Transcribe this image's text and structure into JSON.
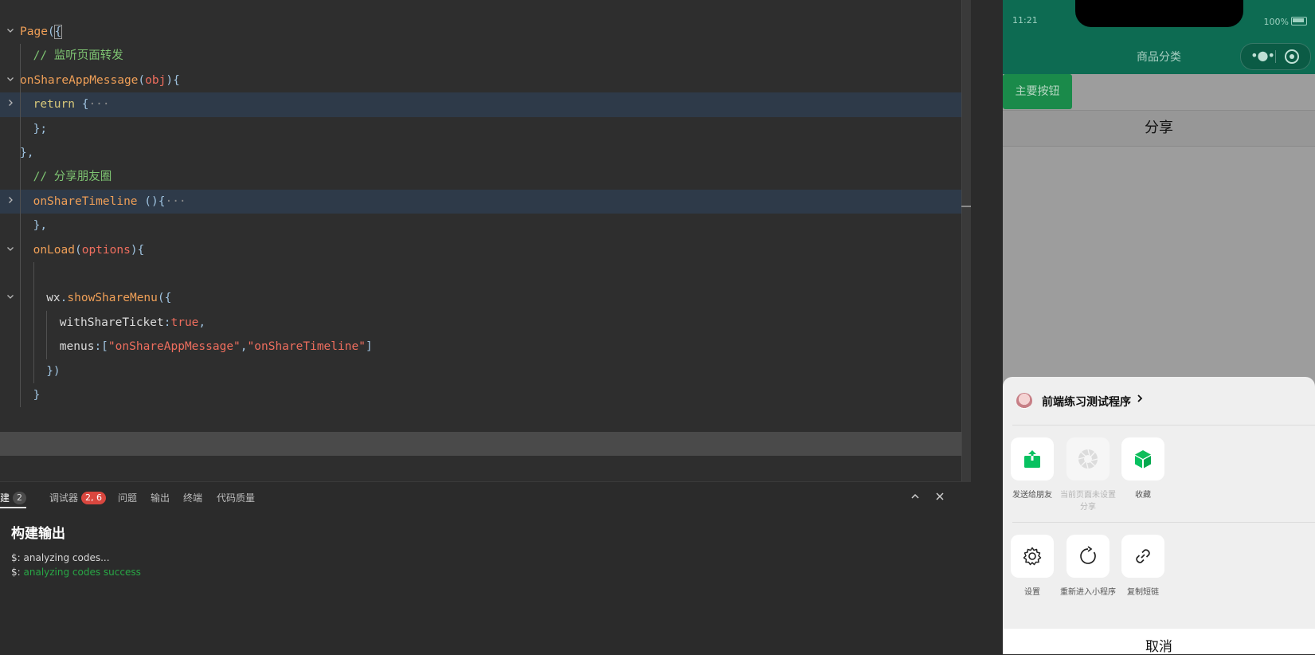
{
  "editor": {
    "lines": [
      {
        "fold": "open",
        "tokens": [
          {
            "t": "Page",
            "c": "fn"
          },
          {
            "t": "(",
            "c": "punc"
          },
          {
            "t": "{",
            "c": "punc",
            "box": true
          }
        ]
      },
      {
        "indent": 1,
        "tokens": [
          {
            "t": "// 监听页面转发",
            "c": "comment"
          }
        ]
      },
      {
        "fold": "open",
        "tokens": [
          {
            "t": "onShareAppMessage",
            "c": "fn"
          },
          {
            "t": "(",
            "c": "punc"
          },
          {
            "t": "obj",
            "c": "param"
          },
          {
            "t": "){",
            "c": "punc"
          }
        ]
      },
      {
        "fold": "closed",
        "hl": true,
        "indent": 1,
        "tokens": [
          {
            "t": "return ",
            "c": "kw"
          },
          {
            "t": "{",
            "c": "punc"
          },
          {
            "t": "···",
            "c": "ellipsis"
          }
        ]
      },
      {
        "indent": 1,
        "tokens": [
          {
            "t": "};",
            "c": "punc"
          }
        ]
      },
      {
        "tokens": [
          {
            "t": "},",
            "c": "punc"
          }
        ]
      },
      {
        "indent": 1,
        "tokens": [
          {
            "t": "// 分享朋友圈",
            "c": "comment"
          }
        ]
      },
      {
        "fold": "closed",
        "hl": true,
        "indent": 1,
        "tokens": [
          {
            "t": "onShareTimeline",
            "c": "fn"
          },
          {
            "t": " (){",
            "c": "punc"
          },
          {
            "t": "···",
            "c": "ellipsis"
          }
        ]
      },
      {
        "indent": 1,
        "tokens": [
          {
            "t": "},",
            "c": "punc"
          }
        ]
      },
      {
        "fold": "open",
        "indent": 1,
        "tokens": [
          {
            "t": "onLoad",
            "c": "fn"
          },
          {
            "t": "(",
            "c": "punc"
          },
          {
            "t": "options",
            "c": "param"
          },
          {
            "t": "){",
            "c": "punc"
          }
        ]
      },
      {
        "indent": 1,
        "tokens": []
      },
      {
        "fold": "open",
        "indent": 2,
        "tokens": [
          {
            "t": "wx",
            "c": "prop"
          },
          {
            "t": ".",
            "c": "punc"
          },
          {
            "t": "showShareMenu",
            "c": "fn"
          },
          {
            "t": "({",
            "c": "punc"
          }
        ]
      },
      {
        "indent": 3,
        "tokens": [
          {
            "t": "withShareTicket",
            "c": "prop"
          },
          {
            "t": ":",
            "c": "punc"
          },
          {
            "t": "true",
            "c": "bool"
          },
          {
            "t": ",",
            "c": "punc"
          }
        ]
      },
      {
        "indent": 3,
        "tokens": [
          {
            "t": "menus",
            "c": "prop"
          },
          {
            "t": ":[",
            "c": "punc"
          },
          {
            "t": "\"onShareAppMessage\"",
            "c": "str"
          },
          {
            "t": ",",
            "c": "punc"
          },
          {
            "t": "\"onShareTimeline\"",
            "c": "str"
          },
          {
            "t": "]",
            "c": "punc"
          }
        ]
      },
      {
        "indent": 2,
        "tokens": [
          {
            "t": "})",
            "c": "punc"
          }
        ]
      },
      {
        "indent": 1,
        "tokens": [
          {
            "t": "}",
            "c": "punc"
          }
        ]
      },
      {
        "tokens": []
      },
      {
        "cursor": true,
        "tokens": []
      }
    ]
  },
  "panel": {
    "tabs": [
      {
        "label": "建",
        "badge": "2",
        "badge_style": "grey",
        "active": true
      },
      {
        "label": "调试器",
        "badge": "2, 6",
        "badge_style": "red"
      },
      {
        "label": "问题"
      },
      {
        "label": "输出"
      },
      {
        "label": "终端"
      },
      {
        "label": "代码质量"
      }
    ],
    "collapse_icon": "chevron-up-icon",
    "close_icon": "close-icon",
    "build_title": "构建输出",
    "build_lines": [
      {
        "prefix": "$: ",
        "text": "analyzing codes...",
        "status": "normal"
      },
      {
        "prefix": "$: ",
        "text": "analyzing codes success",
        "status": "success"
      }
    ]
  },
  "simulator": {
    "status_time": "11:21",
    "battery_text": "100%",
    "nav_title": "商品分类",
    "primary_button": "主要按钮",
    "share_button": "分享",
    "header_color": "#0d6b52",
    "sheet": {
      "app_name": "前端练习测试程序",
      "app_chevron": "›",
      "row1": [
        {
          "label": "发送给朋友",
          "icon": "share-out-icon",
          "disabled": false
        },
        {
          "label": "当前页面未设置分享",
          "icon": "moments-icon",
          "disabled": true
        },
        {
          "label": "收藏",
          "icon": "favorite-cube-icon",
          "disabled": false
        }
      ],
      "row2": [
        {
          "label": "设置",
          "icon": "settings-gear-icon",
          "disabled": false
        },
        {
          "label": "重新进入小程序",
          "icon": "reload-icon",
          "disabled": false
        },
        {
          "label": "复制短链",
          "icon": "link-icon",
          "disabled": false
        }
      ],
      "cancel": "取消"
    }
  }
}
